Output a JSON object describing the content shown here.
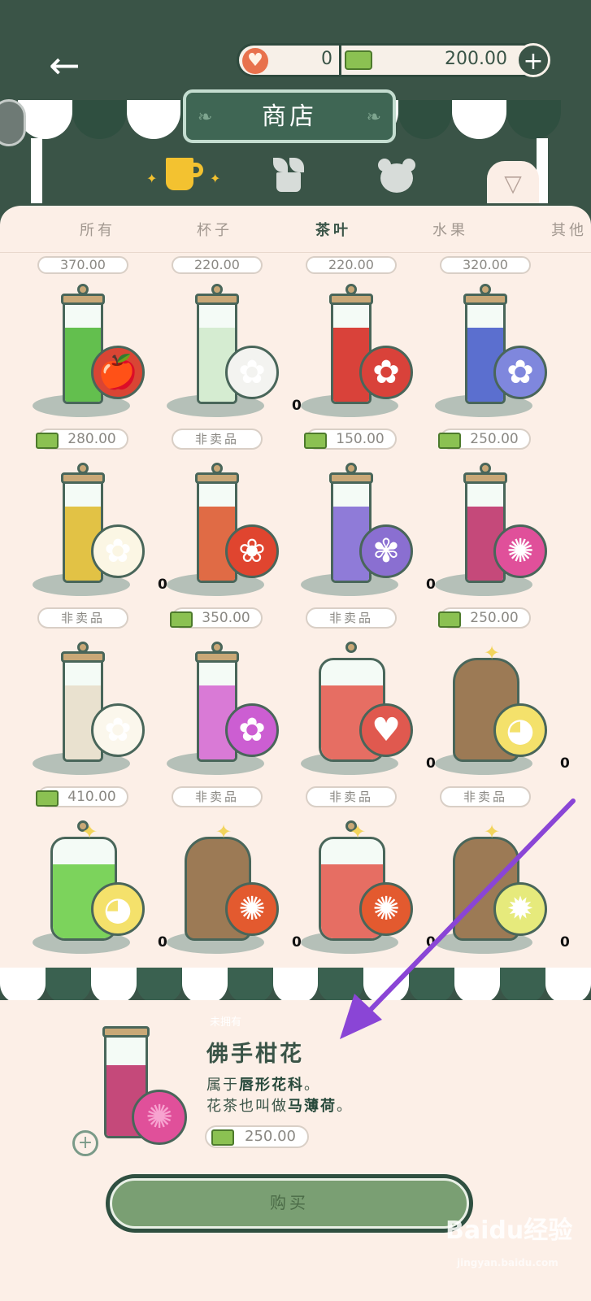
{
  "topbar": {
    "hearts": "0",
    "money": "200.00"
  },
  "shop": {
    "title": "商店"
  },
  "tabs": [
    "所有",
    "杯子",
    "茶叶",
    "水果",
    "其他"
  ],
  "active_tab": "茶叶",
  "peek_prices": [
    "370.00",
    "220.00",
    "220.00",
    "320.00"
  ],
  "items": [
    {
      "price": "280.00",
      "quantity": "",
      "fill": "#63bf4e",
      "flower": "🍎",
      "flower_color": "#d94534"
    },
    {
      "price": "非卖品",
      "quantity": "0",
      "fill": "#d5ecd1",
      "flower": "✿",
      "flower_color": "#f3f3f0"
    },
    {
      "price": "150.00",
      "quantity": "",
      "fill": "#d9423a",
      "flower": "✿",
      "flower_color": "#d9423a"
    },
    {
      "price": "250.00",
      "quantity": "",
      "fill": "#5b6fcf",
      "flower": "✿",
      "flower_color": "#7f87dd"
    },
    {
      "price": "非卖品",
      "quantity": "0",
      "fill": "#e2c245",
      "flower": "✿",
      "flower_color": "#fbf6e4"
    },
    {
      "price": "350.00",
      "quantity": "",
      "fill": "#e06b45",
      "flower": "❀",
      "flower_color": "#e0452f"
    },
    {
      "price": "非卖品",
      "quantity": "0",
      "fill": "#8f7bd8",
      "flower": "✾",
      "flower_color": "#8a6fd1"
    },
    {
      "price": "250.00",
      "quantity": "",
      "fill": "#c5497a",
      "flower": "✺",
      "flower_color": "#e0509a"
    },
    {
      "price": "410.00",
      "quantity": "",
      "fill": "#e9e1cf",
      "flower": "✿",
      "flower_color": "#fbf7ec"
    },
    {
      "price": "非卖品",
      "quantity": "",
      "fill": "#d97ad6",
      "flower": "✿",
      "flower_color": "#cc5ed2"
    },
    {
      "price": "非卖品",
      "quantity": "0",
      "fill": "#e66e63",
      "flower": "♥",
      "flower_color": "#e0594f"
    },
    {
      "price": "非卖品",
      "quantity": "0",
      "fill": "#9c7a55",
      "flower": "◕",
      "flower_color": "#f4e16b"
    },
    {
      "price": "",
      "quantity": "0",
      "fill": "#7cd35c",
      "flower": "◕",
      "flower_color": "#f4e16b"
    },
    {
      "price": "",
      "quantity": "0",
      "fill": "#9c7a55",
      "flower": "✺",
      "flower_color": "#e35a2f"
    },
    {
      "price": "",
      "quantity": "0",
      "fill": "#e66e63",
      "flower": "✺",
      "flower_color": "#e35a2f"
    },
    {
      "price": "",
      "quantity": "0",
      "fill": "#9c7a55",
      "flower": "✹",
      "flower_color": "#e6ea7c"
    }
  ],
  "detail": {
    "tag": "未拥有",
    "name": "佛手柑花",
    "desc_prefix1": "属于",
    "desc_bold1": "唇形花科",
    "desc_suffix1": "。",
    "desc_prefix2": "花茶也叫做",
    "desc_bold2": "马薄荷",
    "desc_suffix2": "。",
    "price": "250.00",
    "buy_label": "购买"
  },
  "colors": {
    "accent": "#3a5447",
    "arrow": "#8a45d6",
    "cash": "#8bc152"
  },
  "watermark": {
    "brand": "Baidu经验",
    "url": "jingyan.baidu.com"
  }
}
